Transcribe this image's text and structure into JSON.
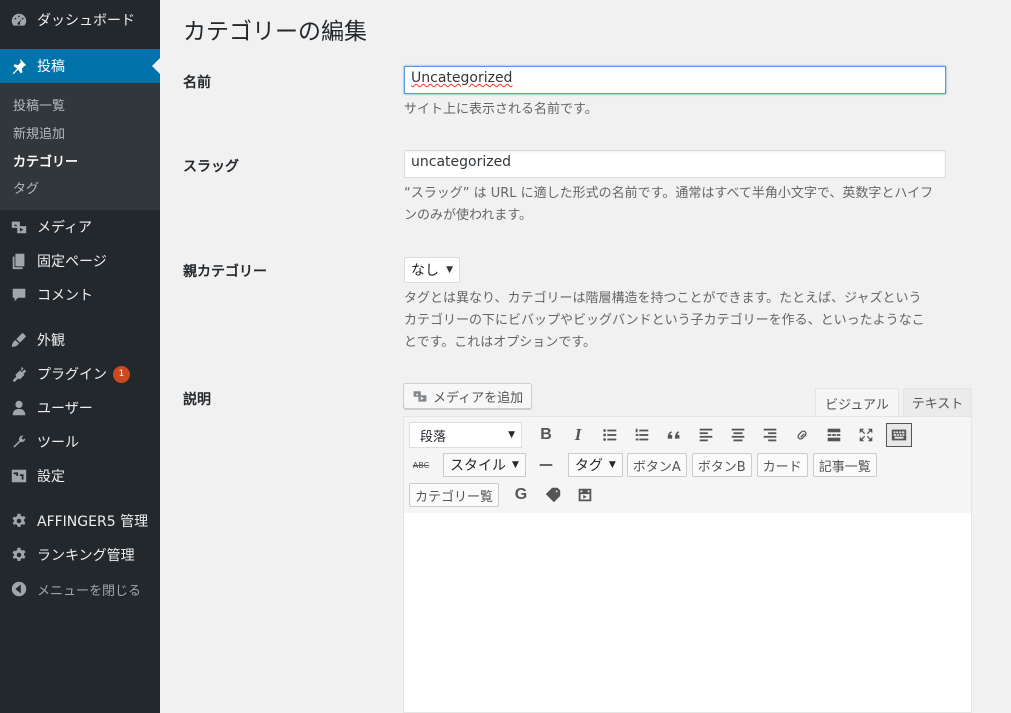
{
  "sidebar": {
    "dashboard": "ダッシュボード",
    "posts": "投稿",
    "sub": [
      "投稿一覧",
      "新規追加",
      "カテゴリー",
      "タグ"
    ],
    "media": "メディア",
    "pages": "固定ページ",
    "comments": "コメント",
    "appearance": "外観",
    "plugins": "プラグイン",
    "plugins_badge": "1",
    "users": "ユーザー",
    "tools": "ツール",
    "settings": "設定",
    "affinger": "AFFINGER5 管理",
    "ranking": "ランキング管理",
    "collapse": "メニューを閉じる"
  },
  "page": {
    "title": "カテゴリーの編集"
  },
  "form": {
    "name_label": "名前",
    "name_value": "Uncategorized",
    "name_desc": "サイト上に表示される名前です。",
    "slug_label": "スラッグ",
    "slug_value": "uncategorized",
    "slug_desc_1": "“スラッグ” は URL に適した形式の名前です。通常はすべて半角小文字で、英数字とハイフ",
    "slug_desc_2": "ンのみが使われます。",
    "parent_label": "親カテゴリー",
    "parent_value": "なし",
    "parent_desc_1": "タグとは異なり、カテゴリーは階層構造を持つことができます。たとえば、ジャズという",
    "parent_desc_2": "カテゴリーの下にビバップやビッグバンドという子カテゴリーを作る、といったようなこ",
    "parent_desc_3": "とです。これはオプションです。",
    "desc_label": "説明"
  },
  "editor": {
    "add_media": "メディアを追加",
    "tab_visual": "ビジュアル",
    "tab_text": "テキスト",
    "format": "段落",
    "style_drop": "スタイル",
    "tag_drop": "タグ",
    "btn_a": "ボタンA",
    "btn_b": "ボタンB",
    "card": "カード",
    "article_list": "記事一覧",
    "category_list": "カテゴリー覧",
    "abc": "ABC"
  }
}
